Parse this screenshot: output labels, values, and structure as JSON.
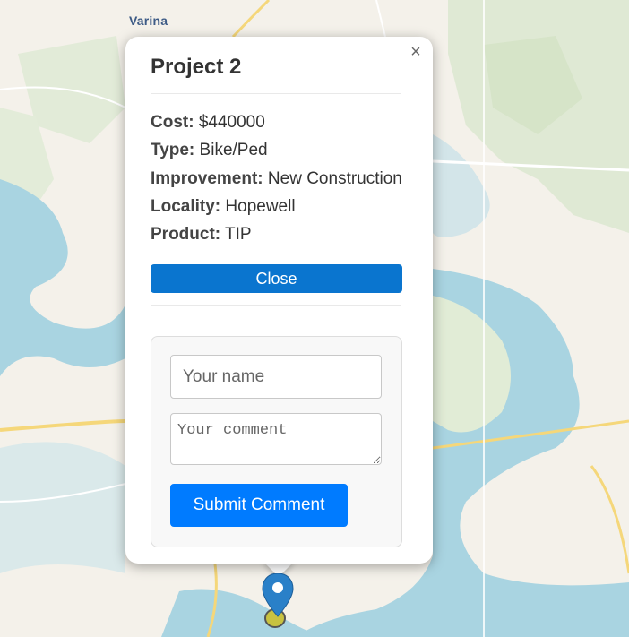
{
  "map": {
    "place_label": "Varina"
  },
  "popup": {
    "title": "Project 2",
    "close_icon": "close-icon",
    "fields": [
      {
        "label": "Cost:",
        "value": "$440000"
      },
      {
        "label": "Type:",
        "value": "Bike/Ped"
      },
      {
        "label": "Improvement:",
        "value": "New Construction"
      },
      {
        "label": "Locality:",
        "value": "Hopewell"
      },
      {
        "label": "Product:",
        "value": "TIP"
      }
    ],
    "close_button_label": "Close"
  },
  "comment_form": {
    "name_placeholder": "Your name",
    "comment_placeholder": "Your comment",
    "submit_label": "Submit Comment"
  },
  "colors": {
    "close_button": "#0a75cf",
    "submit_button": "#007bff",
    "marker": "#2a80c8",
    "marker_dot": "#c8c241"
  }
}
